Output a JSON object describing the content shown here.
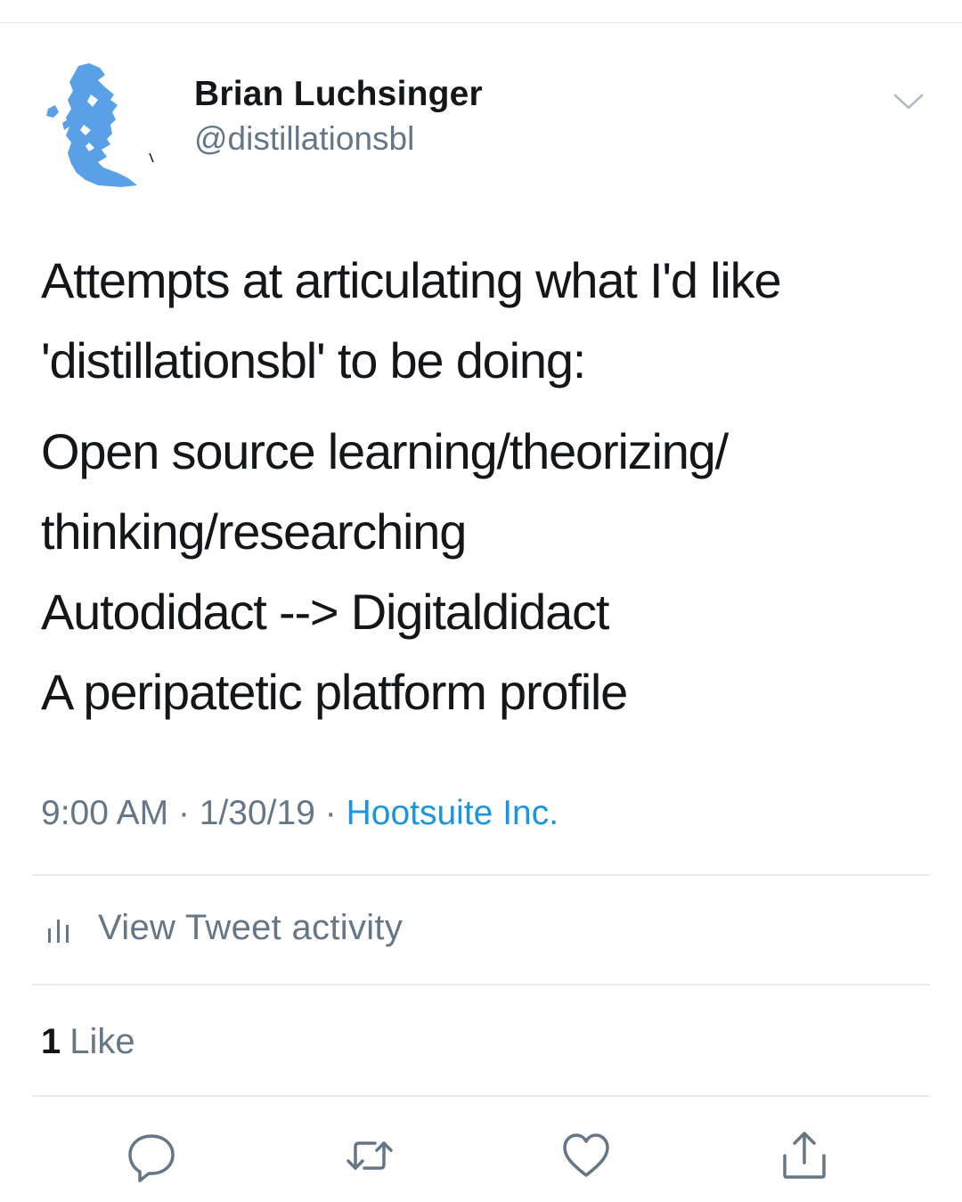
{
  "tweet": {
    "author": {
      "display_name": "Brian Luchsinger",
      "handle": "@distillationsbl",
      "avatar_icon": "avatar-profile-silhouette"
    },
    "text_lines": [
      "Attempts at articulating what I'd like",
      "'distillationsbl' to be doing:"
    ],
    "list_lines": [
      "Open source learning/theorizing/",
      "thinking/researching",
      "Autodidact --> Digitaldidact",
      "A peripatetic platform profile"
    ],
    "meta": {
      "time": "9:00 AM",
      "separator": "·",
      "date": "1/30/19",
      "source": "Hootsuite Inc."
    },
    "activity_label": "View Tweet activity",
    "likes": {
      "count": "1",
      "label": "Like"
    }
  },
  "icons": {
    "menu": "chevron-down-icon",
    "activity": "bar-chart-icon",
    "reply": "reply-icon",
    "retweet": "retweet-icon",
    "like": "heart-icon",
    "share": "share-icon"
  },
  "colors": {
    "text": "#14171a",
    "secondary": "#657786",
    "link": "#1b95e0",
    "avatar": "#5aa0e6",
    "divider": "#e6ecf0"
  }
}
